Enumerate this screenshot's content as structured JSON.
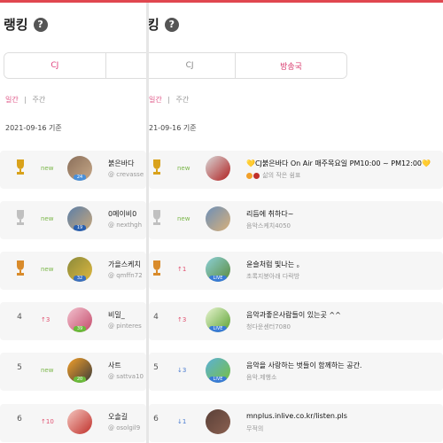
{
  "left": {
    "title": "랭킹",
    "help": "?",
    "tabs": [
      "CJ",
      ""
    ],
    "sub": {
      "daily": "일간",
      "sep": "|",
      "weekly": "주간"
    },
    "date": "2021-09-16 기준",
    "rows": [
      {
        "rank": "1",
        "trophy": "gold",
        "status": "new",
        "name": "붉은바다",
        "id": "@ crevasse",
        "level": "24"
      },
      {
        "rank": "2",
        "trophy": "silver",
        "status": "new",
        "name": "0메이비0",
        "id": "@ nexthgh",
        "level": "19"
      },
      {
        "rank": "3",
        "trophy": "bronze",
        "status": "new",
        "name": "가을스케치",
        "id": "@ qmffn72",
        "level": "32"
      },
      {
        "rank": "4",
        "trophy": "",
        "status": "↑3",
        "name": "비밀_",
        "id": "@ pinteres",
        "level": "39"
      },
      {
        "rank": "5",
        "trophy": "",
        "status": "new",
        "name": "사트",
        "id": "@ sattva10",
        "level": "20"
      },
      {
        "rank": "6",
        "trophy": "",
        "status": "↑10",
        "name": "오솔길",
        "id": "@ osolgil9",
        "level": ""
      }
    ]
  },
  "right": {
    "title": "킹",
    "help": "?",
    "tabs": [
      "CJ",
      "방송국"
    ],
    "sub": {
      "daily": "일간",
      "sep": "|",
      "weekly": "주간"
    },
    "date": "21-09-16 기준",
    "live": "LIVE",
    "rows": [
      {
        "rank": "1",
        "trophy": "gold",
        "status": "new",
        "title": "💛CJ붉은바다 On Air 매주목요일 PM10:00 ~ PM12:00💛",
        "sub": "삶의 작은 쉼표",
        "live": false
      },
      {
        "rank": "2",
        "trophy": "silver",
        "status": "new",
        "title": "리듬에 취하다~",
        "sub": "음악스케치4050",
        "live": false
      },
      {
        "rank": "3",
        "trophy": "bronze",
        "status": "↑1",
        "title": "윤슬처럼 빛나는 。",
        "sub": "초록지붕아래 다락방",
        "live": true
      },
      {
        "rank": "4",
        "trophy": "",
        "status": "↑3",
        "title": "음악과좋은사람들이 있는곳 ^^",
        "sub": "청다운센터7080",
        "live": true
      },
      {
        "rank": "5",
        "trophy": "",
        "status": "↓3",
        "title": "음악을 사랑하는 벗들이 함께하는 공간.",
        "sub": "음악.제행소",
        "live": true
      },
      {
        "rank": "6",
        "trophy": "",
        "status": "↓1",
        "title": "mnplus.inlive.co.kr/listen.pls",
        "sub": "무적의",
        "live": false
      }
    ]
  },
  "colors": {
    "accent": "#e0427e",
    "gold": "#d9a21b",
    "silver": "#c0c0c0",
    "bronze": "#d98b2b"
  }
}
